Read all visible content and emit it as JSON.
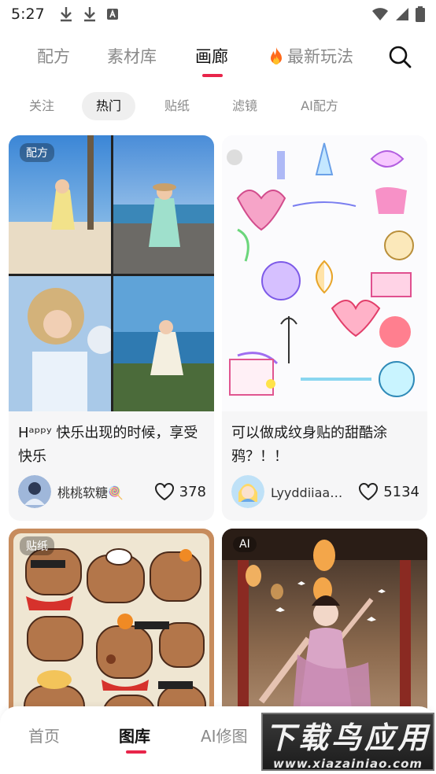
{
  "status_bar": {
    "time": "5:27"
  },
  "top_tabs": [
    {
      "label": "配方"
    },
    {
      "label": "素材库"
    },
    {
      "label": "画廊"
    },
    {
      "label": "最新玩法"
    }
  ],
  "sub_tabs": [
    {
      "label": "关注"
    },
    {
      "label": "热门"
    },
    {
      "label": "贴纸"
    },
    {
      "label": "滤镜"
    },
    {
      "label": "AI配方"
    }
  ],
  "cards": [
    {
      "badge": "配方",
      "title": "Hᵃᵖᵖʸ 快乐出现的时候，享受快乐",
      "author": "桃桃软糖🍭",
      "likes": "378"
    },
    {
      "badge": "",
      "title": "可以做成纹身贴的甜酷涂鸦？！！",
      "author": "Lyyddiiaa莉...",
      "likes": "5134"
    },
    {
      "badge": "贴纸"
    },
    {
      "badge": "AI"
    }
  ],
  "bottom_nav": [
    {
      "label": "首页"
    },
    {
      "label": "图库"
    },
    {
      "label": "AI修图"
    }
  ],
  "watermark": {
    "main": "下载鸟应用",
    "sub": "www.xiazainiao.com"
  },
  "colors": {
    "accent": "#e8254a"
  }
}
